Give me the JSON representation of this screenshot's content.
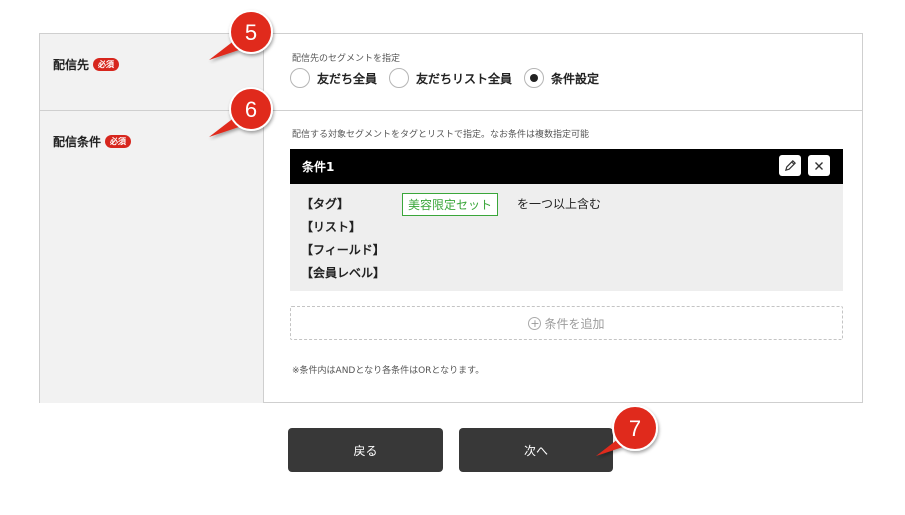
{
  "delivery_target": {
    "label": "配信先",
    "required_badge": "必須",
    "hint": "配信先のセグメントを指定",
    "options": [
      {
        "label": "友だち全員",
        "checked": false
      },
      {
        "label": "友だちリスト全員",
        "checked": false
      },
      {
        "label": "条件設定",
        "checked": true
      }
    ]
  },
  "delivery_condition": {
    "label": "配信条件",
    "required_badge": "必須",
    "hint": "配信する対象セグメントをタグとリストで指定。なお条件は複数指定可能",
    "condition_card": {
      "title": "条件1",
      "edit_icon": "pencil-icon",
      "close_icon": "close-icon",
      "rows": [
        {
          "key": "【タグ】",
          "tag": "美容限定セット",
          "suffix": "を一つ以上含む"
        },
        {
          "key": "【リスト】"
        },
        {
          "key": "【フィールド】"
        },
        {
          "key": "【会員レベル】"
        }
      ]
    },
    "add_condition_label": "条件を追加",
    "note": "※条件内はANDとなり各条件はORとなります。"
  },
  "buttons": {
    "back_label": "戻る",
    "next_label": "次へ"
  },
  "callouts": [
    "5",
    "6",
    "7"
  ],
  "colors": {
    "callout_red": "#e02a1e",
    "required_red": "#d7261d",
    "tag_green": "#3aa63a",
    "button_dark": "#383838"
  }
}
